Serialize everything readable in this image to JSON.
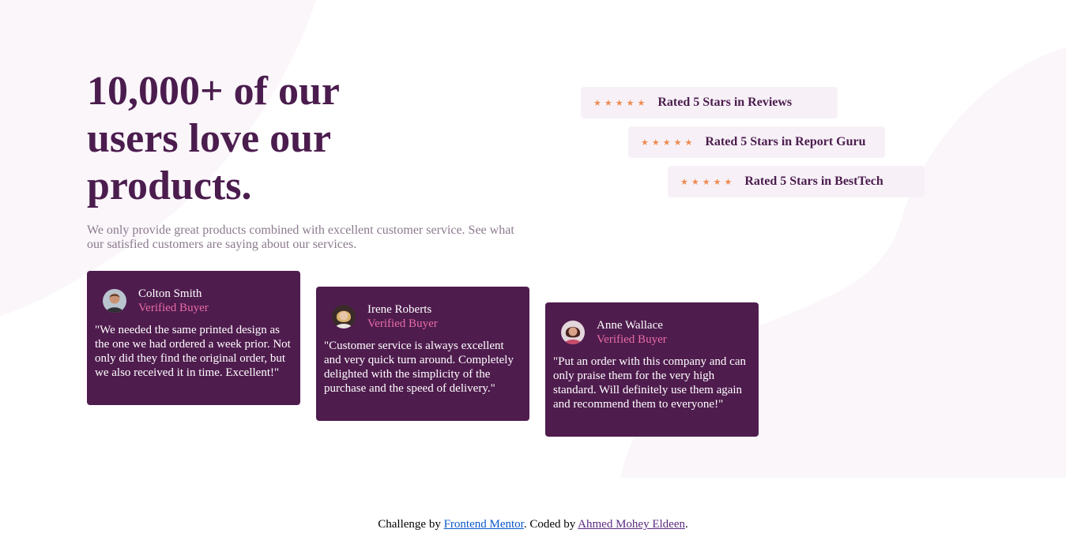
{
  "hero": {
    "title": "10,000+ of our users love our products.",
    "description": "We only provide great products combined with excellent customer service. See what our satisfied customers are saying about our services."
  },
  "ratings": [
    {
      "stars": 5,
      "label": "Rated 5 Stars in Reviews"
    },
    {
      "stars": 5,
      "label": "Rated 5 Stars in Report Guru"
    },
    {
      "stars": 5,
      "label": "Rated 5 Stars in BestTech"
    }
  ],
  "testimonials": [
    {
      "name": "Colton Smith",
      "badge": "Verified Buyer",
      "quote": "\"We needed the same printed design as the one we had ordered a week prior. Not only did they find the original order, but we also received it in time. Excellent!\""
    },
    {
      "name": "Irene Roberts",
      "badge": "Verified Buyer",
      "quote": "\"Customer service is always excellent and very quick turn around. Completely delighted with the simplicity of the purchase and the speed of delivery.\""
    },
    {
      "name": "Anne Wallace",
      "badge": "Verified Buyer",
      "quote": "\"Put an order with this company and can only praise them for the very high standard. Will definitely use them again and recommend them to everyone!\""
    }
  ],
  "footer": {
    "prefix": "Challenge by ",
    "link1": "Frontend Mentor",
    "middle": ". Coded by ",
    "link2": "Ahmed Mohey Eldeen",
    "suffix": "."
  },
  "colors": {
    "primary": "#4b1c4e",
    "card_bg": "#4f1c4e",
    "accent_pink": "#e86ca6",
    "star": "#ee8b51",
    "rating_bg": "#f7f1f7",
    "muted_text": "#8c7a8e"
  },
  "icons": {
    "star": "star-icon",
    "avatar": "avatar"
  }
}
